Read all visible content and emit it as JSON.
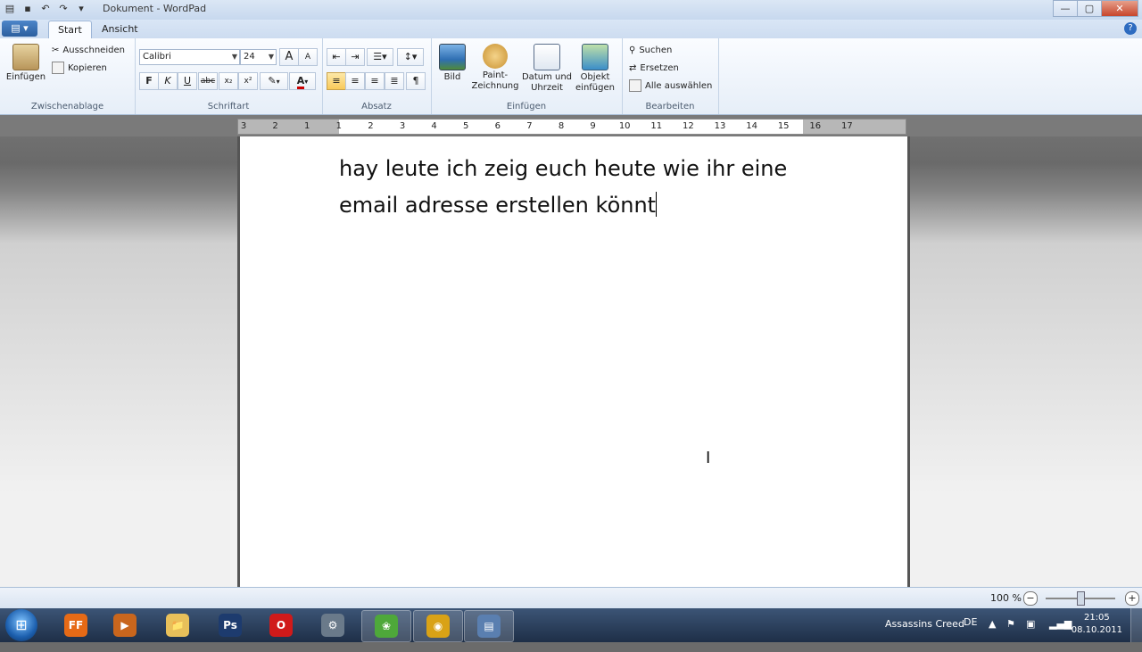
{
  "window": {
    "title": "Dokument - WordPad",
    "controls": {
      "minimize": "—",
      "maximize": "▢",
      "close": "✕"
    }
  },
  "ribbon": {
    "app_button": "▤ ▾",
    "tabs": [
      {
        "label": "Start",
        "active": true
      },
      {
        "label": "Ansicht",
        "active": false
      }
    ],
    "help": "?",
    "clipboard": {
      "paste": "Einfügen",
      "cut": "Ausschneiden",
      "copy": "Kopieren",
      "group_label": "Zwischenablage"
    },
    "font": {
      "family": "Calibri",
      "size": "24",
      "grow": "A",
      "shrink": "A",
      "bold": "F",
      "italic": "K",
      "underline": "U",
      "strike": "abc",
      "subscript": "x₂",
      "superscript": "x²",
      "highlight": "✎",
      "color": "A",
      "group_label": "Schriftart"
    },
    "paragraph": {
      "group_label": "Absatz"
    },
    "insert": {
      "picture": "Bild",
      "paint": "Paint-\nZeichnung",
      "paint_line1": "Paint-",
      "paint_line2": "Zeichnung",
      "datetime_line1": "Datum und",
      "datetime_line2": "Uhrzeit",
      "object_line1": "Objekt",
      "object_line2": "einfügen",
      "group_label": "Einfügen"
    },
    "editing": {
      "find": "Suchen",
      "replace": "Ersetzen",
      "select_all": "Alle auswählen",
      "group_label": "Bearbeiten"
    }
  },
  "ruler": {
    "ticks": [
      "3",
      "2",
      "1",
      "1",
      "2",
      "3",
      "4",
      "5",
      "6",
      "7",
      "8",
      "9",
      "10",
      "11",
      "12",
      "13",
      "14",
      "15",
      "16",
      "17"
    ]
  },
  "document": {
    "line1": "hay leute ich zeig euch heute wie ihr eine",
    "line2": "email adresse erstellen könnt"
  },
  "status": {
    "zoom": "100 %",
    "zoom_out": "−",
    "zoom_in": "+",
    "zoom_level": 0.5
  },
  "taskbar": {
    "start": "⊞",
    "apps": [
      {
        "name": "firefox",
        "label": "FF",
        "color": "#e66a16"
      },
      {
        "name": "media",
        "label": "▶",
        "color": "#c9661d"
      },
      {
        "name": "explorer",
        "label": "📁",
        "color": "#e8c05a"
      },
      {
        "name": "photoshop",
        "label": "Ps",
        "color": "#1d3b6e"
      },
      {
        "name": "opera",
        "label": "O",
        "color": "#d01a1a"
      },
      {
        "name": "tool",
        "label": "⚙",
        "color": "#6a7a8a"
      },
      {
        "name": "leaf",
        "label": "❀",
        "color": "#4ea83a"
      },
      {
        "name": "chrome",
        "label": "◉",
        "color": "#d9a216"
      },
      {
        "name": "wordpad",
        "label": "▤",
        "color": "#5a7fb0"
      }
    ],
    "tray_text": "Assassins Creed",
    "language": "DE",
    "time": "21:05",
    "date": "08.10.2011"
  }
}
